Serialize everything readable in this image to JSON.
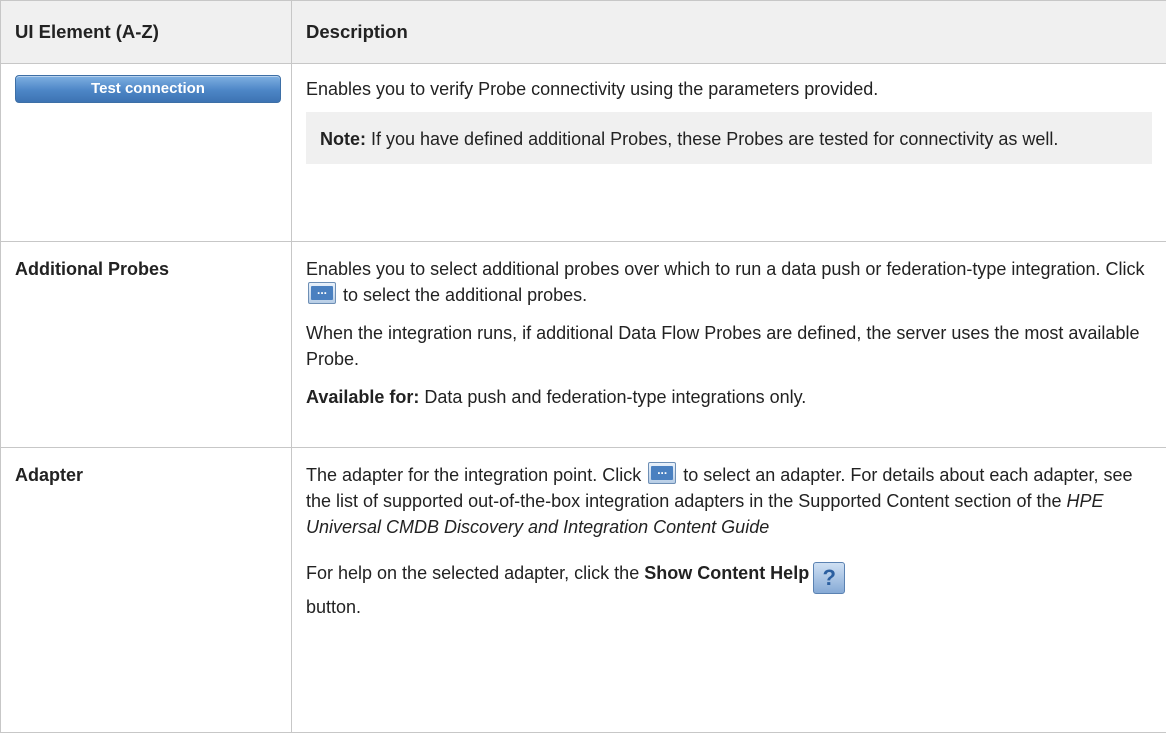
{
  "table": {
    "headers": {
      "element": "UI Element (A-Z)",
      "description": "Description"
    },
    "rows": [
      {
        "element_button_label": "Test connection",
        "desc_p1": "Enables you to verify Probe connectivity using the parameters provided.",
        "note_label": "Note:",
        "note_text": " If you have defined additional Probes, these Probes are tested for connectivity as well."
      },
      {
        "element": "Additional Probes",
        "desc_p1_a": "Enables you to select additional probes over which to run a data push or federation-type integration. Click ",
        "desc_p1_b": " to select the additional probes.",
        "desc_p2": "When the integration runs, if additional Data Flow Probes are defined, the server uses the most available Probe.",
        "avail_label": "Available for:",
        "avail_text": " Data push and federation-type integrations only."
      },
      {
        "element": "Adapter",
        "desc_p1_a": "The adapter for the integration point. Click ",
        "desc_p1_b": " to select an adapter. For details about each adapter, see the list of supported out-of-the-box integration adapters in the Supported Content section of the ",
        "desc_p1_italic": "HPE Universal CMDB Discovery and Integration Content Guide",
        "desc_p2_a": "For help on the selected adapter, click the ",
        "desc_p2_bold": "Show Content Help",
        "desc_p2_b": " button."
      }
    ]
  },
  "icons": {
    "ellipsis_glyph": "...",
    "help_glyph": "?"
  }
}
